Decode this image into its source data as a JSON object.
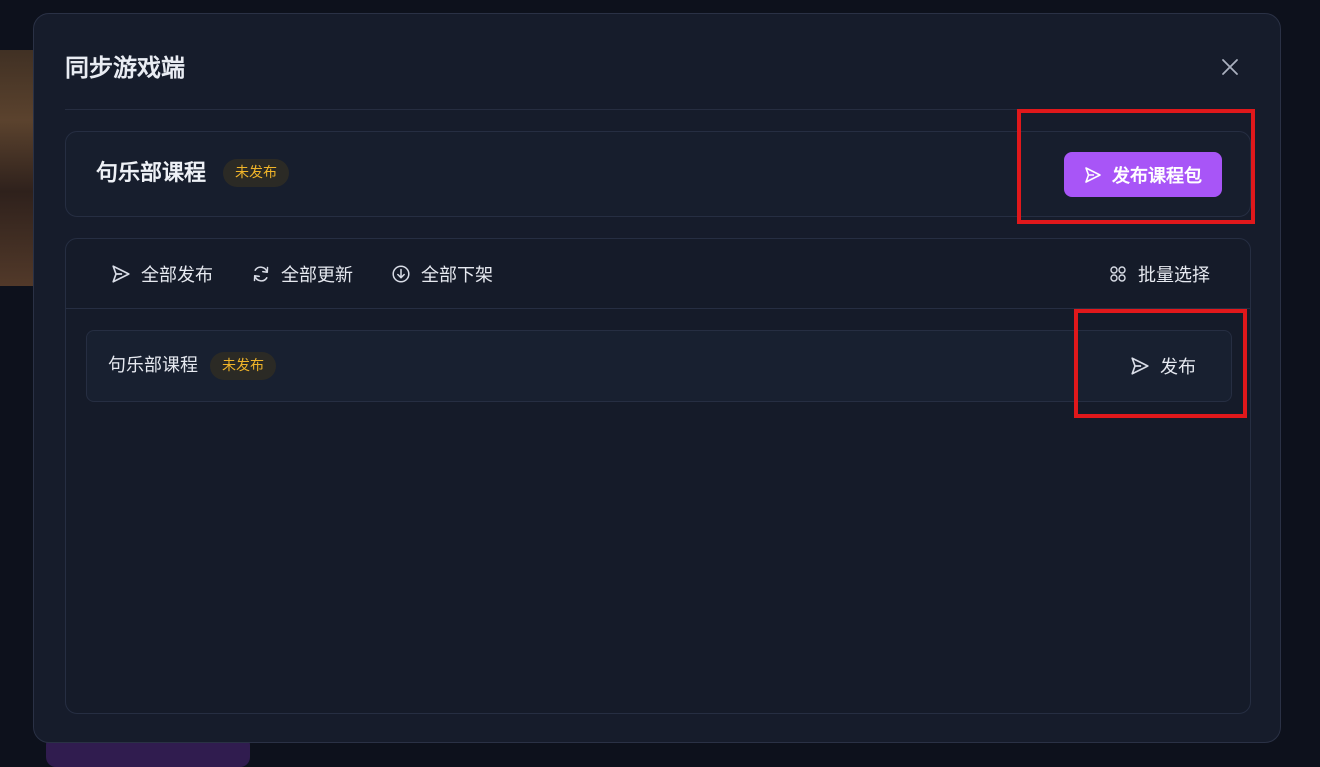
{
  "modal": {
    "title": "同步游戏端",
    "close_icon": "close-icon"
  },
  "course": {
    "name": "句乐部课程",
    "status": "未发布",
    "publish_package_label": "发布课程包",
    "publish_icon": "send-icon"
  },
  "toolbar": {
    "publish_all_label": "全部发布",
    "update_all_label": "全部更新",
    "unpublish_all_label": "全部下架",
    "batch_select_label": "批量选择"
  },
  "rows": [
    {
      "name": "句乐部课程",
      "status": "未发布",
      "action_label": "发布"
    }
  ],
  "colors": {
    "accent": "#a855f7",
    "status_warning": "#f0b429",
    "highlight": "#e0181b"
  }
}
